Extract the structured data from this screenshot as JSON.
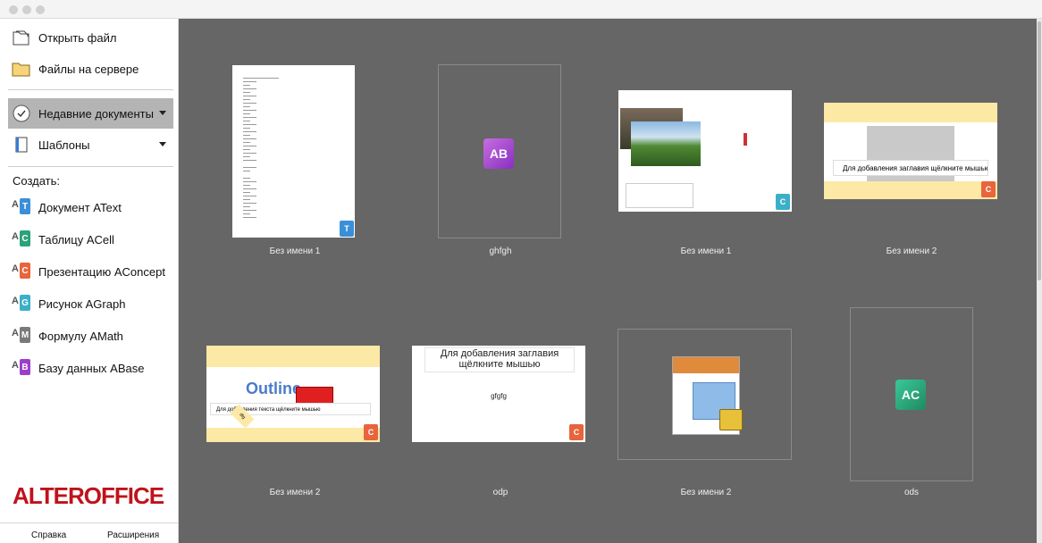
{
  "window": {
    "traffic_lights": 3
  },
  "sidebar": {
    "open_file": "Открыть файл",
    "server_files": "Файлы на сервере",
    "recent": "Недавние документы",
    "templates": "Шаблоны",
    "create_label": "Создать:",
    "create_items": [
      {
        "label": "Документ AText",
        "icon": "atext-icon",
        "color": "#3a8fd8",
        "letter": "T"
      },
      {
        "label": "Таблицу ACell",
        "icon": "acell-icon",
        "color": "#2aa37a",
        "letter": "C"
      },
      {
        "label": "Презентацию AConcept",
        "icon": "aconcept-icon",
        "color": "#e8643c",
        "letter": "C"
      },
      {
        "label": "Рисунок AGraph",
        "icon": "agraph-icon",
        "color": "#3ab0c8",
        "letter": "G"
      },
      {
        "label": "Формулу AMath",
        "icon": "amath-icon",
        "color": "#7a7a7a",
        "letter": "M"
      },
      {
        "label": "Базу данных ABase",
        "icon": "abase-icon",
        "color": "#9b3fc8",
        "letter": "B"
      }
    ],
    "logo_text": "ALTEROFFICE",
    "help": "Справка",
    "extensions": "Расширения"
  },
  "recent_docs": [
    {
      "caption": "Без имени 1",
      "kind": "text"
    },
    {
      "caption": "ghfgh",
      "kind": "base"
    },
    {
      "caption": "Без имени 1",
      "kind": "photo"
    },
    {
      "caption": "Без имени 2",
      "kind": "honey-table"
    },
    {
      "caption": "Без имени 2",
      "kind": "outline"
    },
    {
      "caption": "odp",
      "kind": "slide"
    },
    {
      "caption": "Без имени 2",
      "kind": "locked"
    },
    {
      "caption": "ods",
      "kind": "cell"
    }
  ],
  "thumb_text": {
    "honey_table_title": "Для добавления заглавия щёлкните мышью",
    "slide_title": "Для добавления заглавия щёлкните мышью",
    "slide_body": "gfgfg",
    "outline_word": "Outline",
    "outline_bullet": "Для добавления текста щёлкните мышью",
    "outline_small": "dfg"
  }
}
